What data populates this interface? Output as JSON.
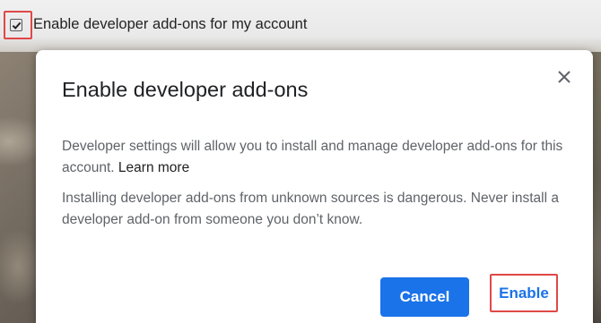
{
  "settings": {
    "checkbox_label": "Enable developer add-ons for my account",
    "checkbox_checked": true
  },
  "dialog": {
    "title": "Enable developer add-ons",
    "close_icon": "close-icon",
    "paragraph1": "Developer settings will allow you to install and manage developer add-ons for this account.",
    "learn_more": "Learn more",
    "paragraph2": "Installing developer add-ons from unknown sources is dangerous. Never install a developer add-on from someone you don’t know.",
    "cancel_label": "Cancel",
    "enable_label": "Enable"
  },
  "colors": {
    "primary": "#1a73e8",
    "highlight": "#e04848",
    "title_text": "#202124",
    "body_text": "#5f6368"
  }
}
